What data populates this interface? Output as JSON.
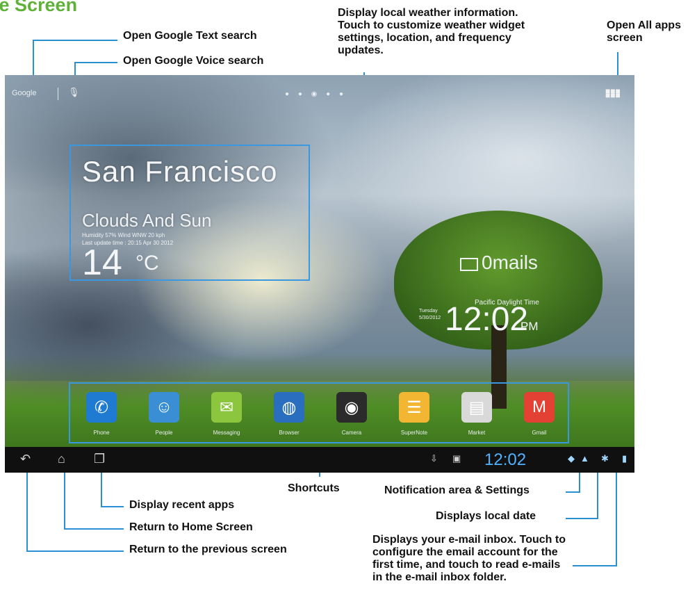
{
  "page_title": "ne Screen",
  "annotations": {
    "google_text": "Open Google Text search",
    "google_voice": "Open Google Voice search",
    "weather": "Display local weather information. Touch to customize weather widget settings, location, and frequency updates.",
    "all_apps": "Open All apps screen",
    "shortcuts": "Shortcuts",
    "notification": "Notification area & Settings",
    "local_date": "Displays local date",
    "email": "Displays your e-mail inbox. Touch to configure the email account for the first time, and touch to read e-mails in the e-mail inbox folder.",
    "recent_apps": "Display recent apps",
    "home": "Return to Home Screen",
    "back": "Return to the previous screen"
  },
  "screen": {
    "google_label": "Google",
    "weather": {
      "city": "San Francisco",
      "condition": "Clouds And Sun",
      "humidity": "Humidity 57%  Wind WNW 20 kph",
      "updated": "Last update time : 20:15 Apr 30 2012",
      "temperature": "14",
      "unit": "°C"
    },
    "email": {
      "text": "0mails"
    },
    "clock": {
      "zone": "Pacific Daylight Time",
      "day": "Tuesday",
      "date": "5/30/2012",
      "time": "12:02",
      "ampm": "PM"
    },
    "shortcuts": [
      {
        "label": "Phone",
        "icon": "phone-icon",
        "glyph": "✆",
        "color": "#1f7bd1"
      },
      {
        "label": "People",
        "icon": "people-icon",
        "glyph": "☺",
        "color": "#3a8fd4"
      },
      {
        "label": "Messaging",
        "icon": "messaging-icon",
        "glyph": "✉",
        "color": "#8cc63f"
      },
      {
        "label": "Browser",
        "icon": "browser-icon",
        "glyph": "◍",
        "color": "#2a6fbf"
      },
      {
        "label": "Camera",
        "icon": "camera-icon",
        "glyph": "◉",
        "color": "#2b2b2b"
      },
      {
        "label": "SuperNote",
        "icon": "supernote-icon",
        "glyph": "☰",
        "color": "#f2b632"
      },
      {
        "label": "Market",
        "icon": "market-icon",
        "glyph": "▤",
        "color": "#d9d9d9"
      },
      {
        "label": "Gmail",
        "icon": "gmail-icon",
        "glyph": "M",
        "color": "#e34133"
      }
    ],
    "status_time": "12:02"
  },
  "accent_color": "#2b8fd6"
}
